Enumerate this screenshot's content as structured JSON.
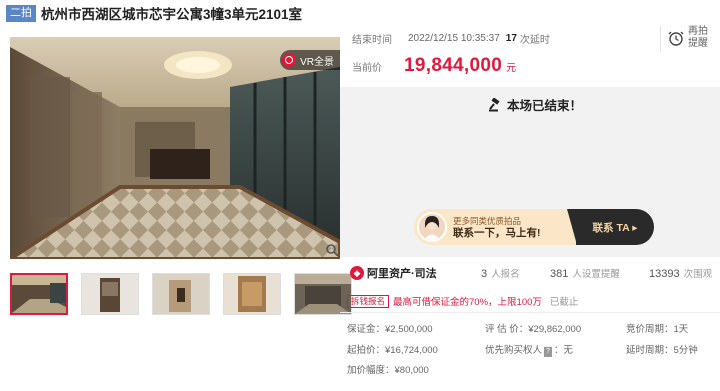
{
  "header": {
    "round": "二拍",
    "title": "杭州市西湖区城市芯宇公寓3幢3单元2101室"
  },
  "media": {
    "vr_label": "VR全景"
  },
  "auction": {
    "end_label": "结束时间",
    "end_time": "2022/12/15 10:35:37",
    "extensions": "17",
    "extensions_label": "次延时",
    "remind_label": "再拍提醒",
    "price_label": "当前价",
    "price": "19,844,000",
    "price_unit": "元",
    "ended_text": "本场已结束！"
  },
  "promo": {
    "small": "更多同类优质拍品",
    "big": "联系一下，马上有!",
    "button": "联系 TA ▸"
  },
  "stats": {
    "platform": "阿里资产·司法",
    "signups": "3",
    "signups_label": "人报名",
    "reminders": "381",
    "reminders_label": "人设置提醒",
    "views": "13393",
    "views_label": "次围观"
  },
  "notice": {
    "tag": "拆钱报名",
    "text": "最高可借保证金的70%，上限100万",
    "status": "已截止"
  },
  "details": {
    "deposit": "保证金：¥2,500,000",
    "appraisal": "评 估 价：¥29,862,000",
    "period": "竞价周期：1天",
    "start_price": "起拍价：¥16,724,000",
    "priority_pre": "优先购买权人",
    "priority_tag": "?",
    "priority_post": "：无",
    "delay": "延时周期：5分钟",
    "increment": "加价幅度：¥80,000"
  },
  "colors": {
    "accent": "#e0193c",
    "round_badge": "#5b86c5",
    "panel": "#f2f2f2"
  }
}
